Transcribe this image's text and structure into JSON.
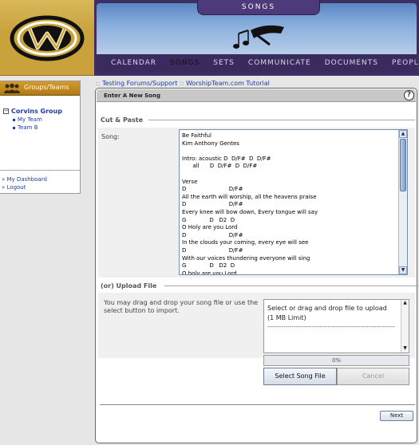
{
  "header": {
    "section_title": "SONGS",
    "nav": [
      "CALENDAR",
      "SONGS",
      "SETS",
      "COMMUNICATE",
      "DOCUMENTS",
      "PEOPLE"
    ],
    "active_nav": "SONGS"
  },
  "sidebar": {
    "header_label": "Groups/Teams",
    "group_name": "Corvins Group",
    "teams": [
      "My Team",
      "Team B"
    ],
    "links": [
      "My Dashboard",
      "Logout"
    ]
  },
  "breadcrumb": {
    "prefix": "::",
    "link1": "Testing Forums/Support",
    "separator": "::",
    "link2": "WorshipTeam.com Tutorial"
  },
  "panel": {
    "title": "Enter A New Song",
    "help": "?",
    "cut_paste_label": "Cut & Paste",
    "song_label": "Song:",
    "song_lines": [
      "Be Faithful",
      "Kim Anthony Gentes",
      "",
      "Intro: acoustic D  D/F#  D  D/F#",
      "      all      D  D/F#  D  D/F#",
      "",
      "Verse",
      "D                        D/F#",
      "All the earth will worship, all the heavens praise",
      "D                        D/F#",
      "Every knee will bow down, Every tongue will say",
      "G             D   D2  D",
      "O Holy are you Lord",
      "D                        D/F#",
      "In the clouds your coming, every eye will see",
      "D                        D/F#",
      "With our voices thundering everyone will sing",
      "G             D   D2  D",
      "O holy are you Lord"
    ],
    "upload_label": "(or) Upload File",
    "upload_help": "You may drag and drop your song file or use the select button to import.",
    "drop_text": "Select or drag and drop file to upload (1 MB Limit)",
    "drop_dashes": "----------------------------------------------------------------",
    "progress_text": "0%",
    "progress_value": 0,
    "select_button": "Select Song File",
    "cancel_button": "Cancel",
    "next_button": "Next"
  },
  "colors": {
    "accent_gold": "#c9a23c",
    "banner_purple": "#3a2b5e",
    "link_blue": "#1e3ca8"
  }
}
